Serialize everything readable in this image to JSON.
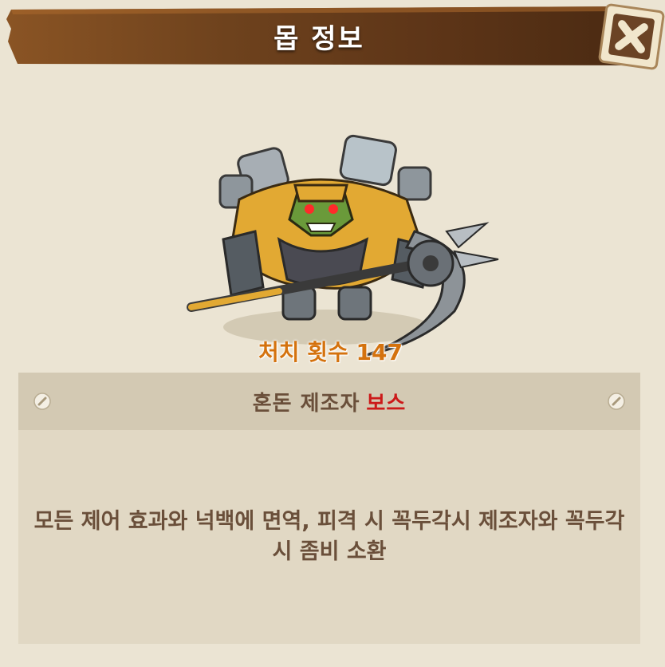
{
  "header": {
    "title": "몹 정보",
    "close_icon": "close-x-icon"
  },
  "monster": {
    "kill_count_label": "처치 횟수 ",
    "kill_count_value": "147",
    "name": "혼돈 제조자",
    "tag": "보스",
    "description": "모든 제어 효과와 넉백에 면역, 피격 시 꼭두각시 제조자와 꼭두각시 좀비 소환"
  },
  "colors": {
    "background": "#ebe4d3",
    "header_brown": "#6b3f1c",
    "title_text": "#ffffff",
    "kill_count": "#d4720e",
    "name_text": "#6a4f3a",
    "boss_tag": "#cc1a1a",
    "name_bar": "#d3c9b3",
    "description_box": "#e1d8c4"
  }
}
